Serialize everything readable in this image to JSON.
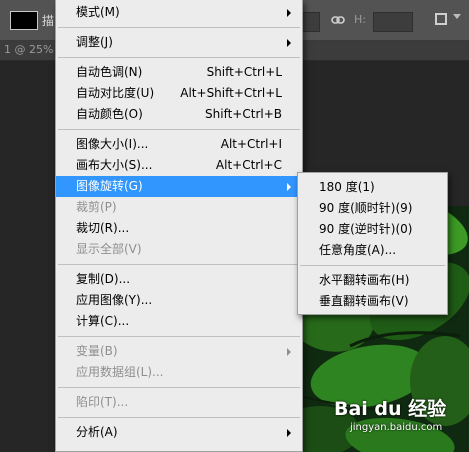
{
  "options_bar": {
    "tool_label": "描",
    "h_label": "H:"
  },
  "doc_tab": {
    "text": "1 @ 25% ("
  },
  "main_menu": {
    "items": [
      {
        "label": "模式(M)",
        "submenu": true
      },
      {
        "label": "调整(J)",
        "submenu": true
      },
      {
        "label": "自动色调(N)",
        "shortcut": "Shift+Ctrl+L"
      },
      {
        "label": "自动对比度(U)",
        "shortcut": "Alt+Shift+Ctrl+L"
      },
      {
        "label": "自动颜色(O)",
        "shortcut": "Shift+Ctrl+B"
      },
      {
        "label": "图像大小(I)...",
        "shortcut": "Alt+Ctrl+I"
      },
      {
        "label": "画布大小(S)...",
        "shortcut": "Alt+Ctrl+C"
      },
      {
        "label": "图像旋转(G)",
        "submenu": true,
        "highlighted": true
      },
      {
        "label": "裁剪(P)",
        "disabled": true
      },
      {
        "label": "裁切(R)..."
      },
      {
        "label": "显示全部(V)",
        "disabled": true
      },
      {
        "label": "复制(D)..."
      },
      {
        "label": "应用图像(Y)..."
      },
      {
        "label": "计算(C)..."
      },
      {
        "label": "变量(B)",
        "submenu": true,
        "disabled": true
      },
      {
        "label": "应用数据组(L)...",
        "disabled": true
      },
      {
        "label": "陷印(T)...",
        "disabled": true
      },
      {
        "label": "分析(A)",
        "submenu": true
      }
    ]
  },
  "rotate_submenu": {
    "items": [
      {
        "label": "180 度(1)"
      },
      {
        "label": "90 度(顺时针)(9)"
      },
      {
        "label": "90 度(逆时针)(0)"
      },
      {
        "label": "任意角度(A)..."
      },
      {
        "label": "水平翻转画布(H)"
      },
      {
        "label": "垂直翻转画布(V)"
      }
    ]
  },
  "watermark": {
    "logo": "Bai du 经验",
    "url": "jingyan.baidu.com"
  },
  "colors": {
    "menu_bg": "#ececec",
    "highlight": "#3296ff",
    "disabled_text": "#8f8f8f",
    "app_bg": "#535353"
  }
}
